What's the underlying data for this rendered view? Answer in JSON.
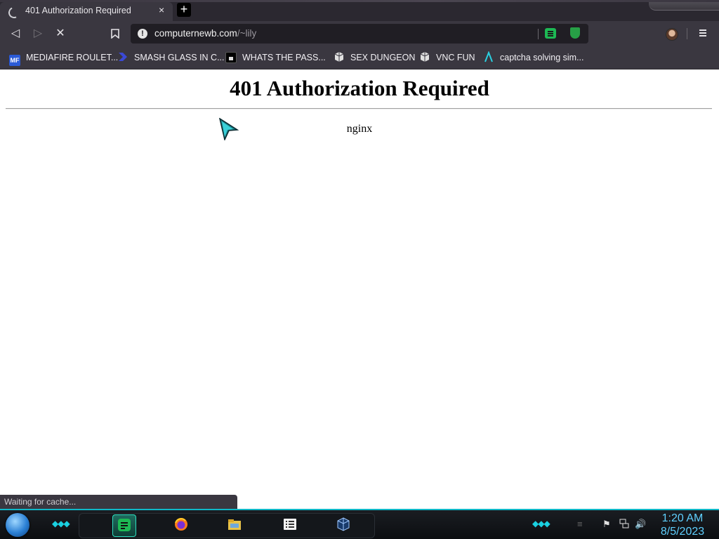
{
  "browser": {
    "tab": {
      "title": "401 Authorization Required",
      "close": "×"
    },
    "new_tab": "+",
    "nav": {
      "back": "◁",
      "forward": "▷",
      "stop": "✕",
      "bookmark": "🔖"
    },
    "url": {
      "host": "computernewb.com",
      "path": "/~lily",
      "info_icon": "!"
    },
    "bookmarks": [
      {
        "label": "MEDIAFIRE ROULET...",
        "icon": "mediafire-icon",
        "color": "#2b5bd7"
      },
      {
        "label": "SMASH GLASS IN C...",
        "icon": "smash-glass-icon",
        "color": "#3b49d6"
      },
      {
        "label": "WHATS THE PASS...",
        "icon": "password-icon",
        "color": "#000000"
      },
      {
        "label": "SEX DUNGEON",
        "icon": "cube-icon",
        "color": "#e0e0e0"
      },
      {
        "label": "VNC FUN",
        "icon": "cube-icon",
        "color": "#e0e0e0"
      },
      {
        "label": "captcha solving sim...",
        "icon": "lambda-icon",
        "color": "#2ad0e0"
      }
    ]
  },
  "page": {
    "heading": "401 Authorization Required",
    "server": "nginx"
  },
  "status_bar": "Waiting for cache...",
  "taskbar": {
    "apps": [
      "spotify-icon",
      "firefox-icon",
      "file-explorer-icon",
      "task-list-icon",
      "virtualbox-icon"
    ],
    "time": "1:20 AM",
    "date": "8/5/2023",
    "accent": "#0fb8c8"
  }
}
